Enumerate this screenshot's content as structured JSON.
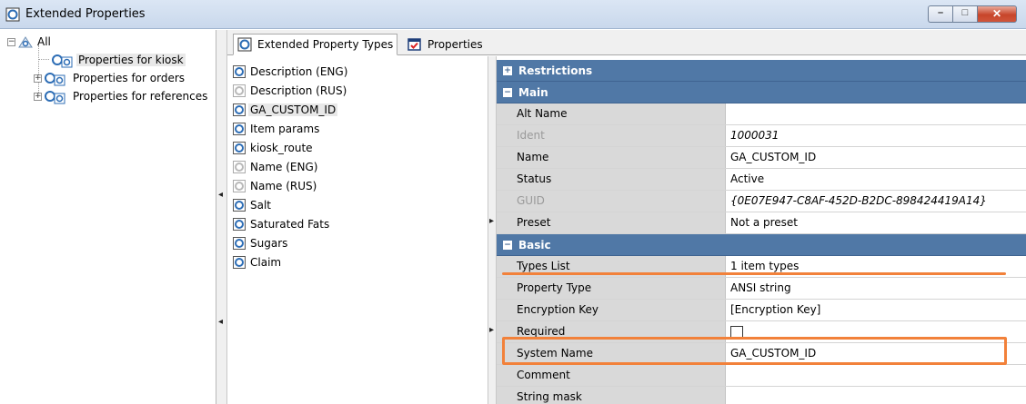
{
  "window": {
    "title": "Extended Properties",
    "minimize": "–",
    "maximize": "□",
    "close": "✕"
  },
  "tree": {
    "root": "All",
    "items": [
      {
        "label": "Properties for kiosk",
        "selected": true
      },
      {
        "label": "Properties for orders",
        "expandable": true
      },
      {
        "label": "Properties for references",
        "expandable": true
      }
    ]
  },
  "tabs": [
    {
      "label": "Extended Property Types",
      "active": true,
      "icon": "property-type-icon"
    },
    {
      "label": "Properties",
      "active": false,
      "icon": "properties-form-icon"
    }
  ],
  "types": [
    {
      "label": "Description (ENG)"
    },
    {
      "label": "Description (RUS)",
      "grey": true
    },
    {
      "label": "GA_CUSTOM_ID",
      "selected": true
    },
    {
      "label": "Item params"
    },
    {
      "label": "kiosk_route"
    },
    {
      "label": "Name (ENG)",
      "grey": true
    },
    {
      "label": "Name (RUS)",
      "grey": true
    },
    {
      "label": "Salt"
    },
    {
      "label": "Saturated Fats"
    },
    {
      "label": "Sugars"
    },
    {
      "label": "Claim"
    }
  ],
  "grid": {
    "categories": {
      "restrictions": "Restrictions",
      "main": "Main",
      "basic": "Basic"
    },
    "main": [
      {
        "name": "Alt Name",
        "value": ""
      },
      {
        "name": "Ident",
        "value": "1000031",
        "disabled": true
      },
      {
        "name": "Name",
        "value": "GA_CUSTOM_ID"
      },
      {
        "name": "Status",
        "value": "Active"
      },
      {
        "name": "GUID",
        "value": "{0E07E947-C8AF-452D-B2DC-898424419A14}",
        "disabled": true
      },
      {
        "name": "Preset",
        "value": "Not a preset"
      }
    ],
    "basic": [
      {
        "name": "Types List",
        "value": "1 item types"
      },
      {
        "name": "Property Type",
        "value": "ANSI string"
      },
      {
        "name": "Encryption Key",
        "value": "[Encryption Key]"
      },
      {
        "name": "Required",
        "value": ""
      },
      {
        "name": "System Name",
        "value": "GA_CUSTOM_ID"
      },
      {
        "name": "Comment",
        "value": ""
      },
      {
        "name": "String mask",
        "value": ""
      }
    ]
  },
  "colors": {
    "category_header": "#5078a6",
    "highlight": "#f2813a",
    "name_cell": "#d9d9d9"
  }
}
